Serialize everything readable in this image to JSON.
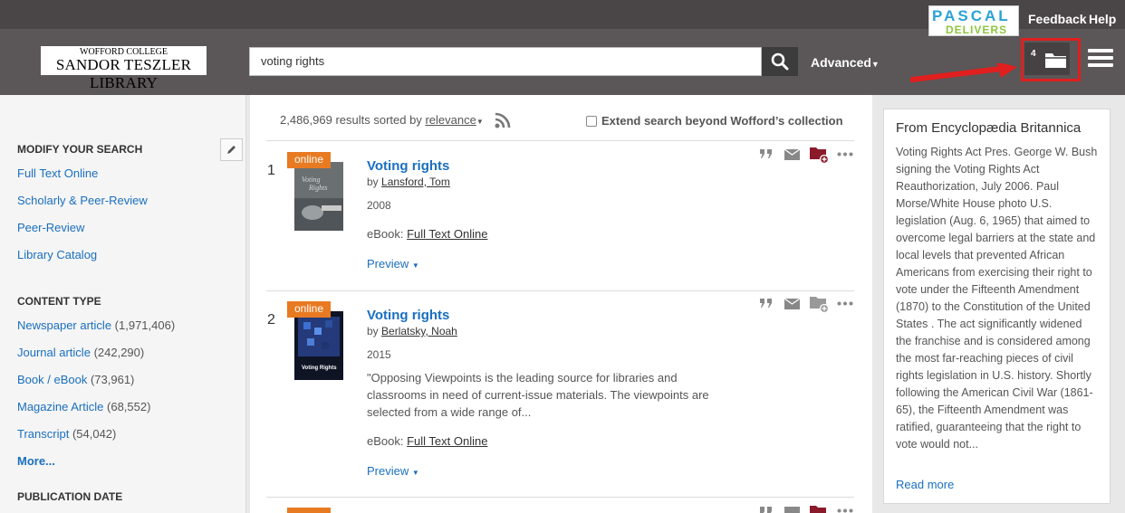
{
  "topbar": {
    "pascal_line1": "PASCAL",
    "pascal_line2": "DELIVERS",
    "feedback": "Feedback",
    "help": "Help"
  },
  "header": {
    "logo_line1": "WOFFORD COLLEGE",
    "logo_line2": "SANDOR TESZLER LIBRARY",
    "search_value": "voting rights",
    "advanced": "Advanced",
    "folder_count": "4"
  },
  "sidebar": {
    "modify_heading": "MODIFY YOUR SEARCH",
    "modify_links": [
      "Full Text Online",
      "Scholarly & Peer-Review",
      "Peer-Review",
      "Library Catalog"
    ],
    "content_heading": "CONTENT TYPE",
    "content_types": [
      {
        "label": "Newspaper article",
        "count": "(1,971,406)"
      },
      {
        "label": "Journal article",
        "count": "(242,290)"
      },
      {
        "label": "Book / eBook",
        "count": "(73,961)"
      },
      {
        "label": "Magazine Article",
        "count": "(68,552)"
      },
      {
        "label": "Transcript",
        "count": "(54,042)"
      }
    ],
    "more": "More...",
    "pubdate_heading": "PUBLICATION DATE"
  },
  "results": {
    "count_text": "2,486,969 results sorted by",
    "sort": "relevance",
    "extend": "Extend search beyond Wofford’s collection",
    "items": [
      {
        "num": "1",
        "badge": "online",
        "title": "Voting rights",
        "by": "by",
        "author": "Lansford, Tom",
        "year": "2008",
        "format_label": "eBook:",
        "format_link": "Full Text Online",
        "preview": "Preview"
      },
      {
        "num": "2",
        "badge": "online",
        "title": "Voting rights",
        "by": "by",
        "author": "Berlatsky, Noah",
        "year": "2015",
        "description": "\"Opposing Viewpoints is the leading source for libraries and classrooms in need of current-issue materials. The viewpoints are selected from a wide range of...",
        "format_label": "eBook:",
        "format_link": "Full Text Online",
        "preview": "Preview"
      }
    ]
  },
  "britannica": {
    "title": "From Encyclopædia Britannica",
    "text": "Voting Rights Act Pres. George W. Bush signing the Voting Rights Act Reauthorization, July 2006. Paul Morse/White House photo U.S. legislation (Aug. 6, 1965) that aimed to overcome legal barriers at the state and local levels that prevented African Americans from exercising their right to vote under the Fifteenth Amendment (1870) to the Constitution of the United States . The act significantly widened the franchise and is considered among the most far-reaching pieces of civil rights legislation in U.S. history. Shortly following the American Civil War (1861-65), the Fifteenth Amendment was ratified, guaranteeing that the right to vote would not...",
    "read_more": "Read more"
  },
  "colors": {
    "accent_link": "#1a6fbf",
    "badge": "#e87a22",
    "highlight_box": "#e01f1f",
    "saved_folder": "#8b1a2b"
  }
}
